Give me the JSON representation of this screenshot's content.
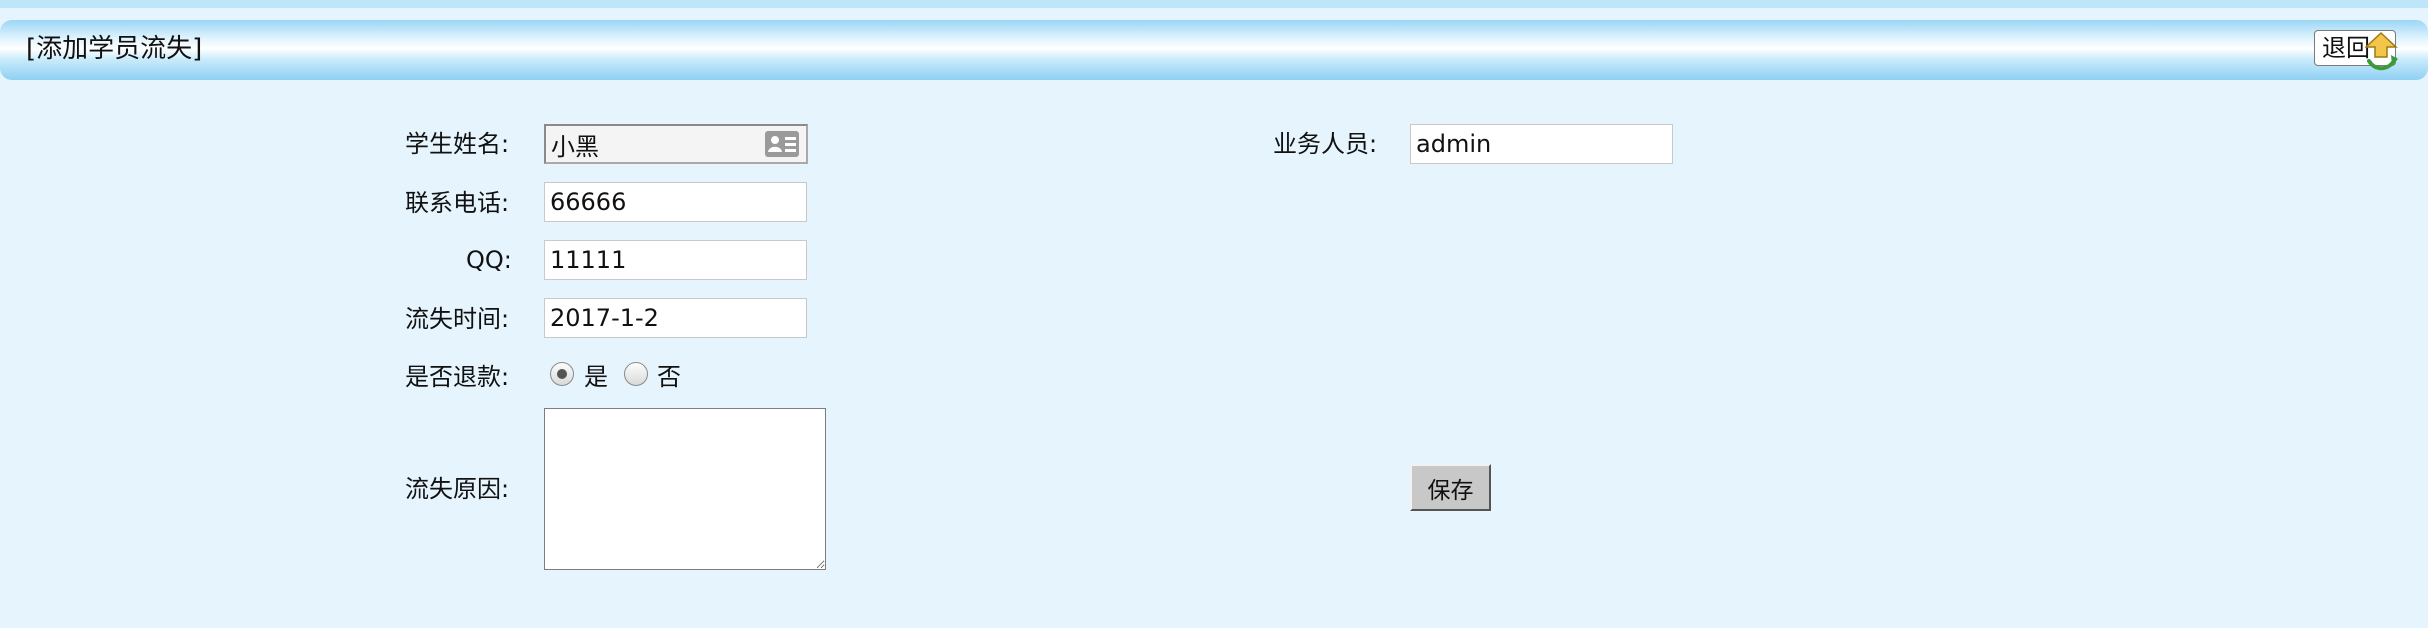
{
  "page": {
    "title": "[添加学员流失]",
    "back_label": "退回"
  },
  "form": {
    "student_name": {
      "label": "学生姓名:",
      "value": "小黑"
    },
    "phone": {
      "label": "联系电话:",
      "value": "66666"
    },
    "qq": {
      "label": "QQ:",
      "value": "11111"
    },
    "churn_date": {
      "label": "流失时间:",
      "value": "2017-1-2"
    },
    "refund": {
      "label": "是否退款:",
      "options": [
        {
          "label": "是",
          "checked": true
        },
        {
          "label": "否",
          "checked": false
        }
      ]
    },
    "reason": {
      "label": "流失原因:",
      "value": ""
    },
    "salesperson": {
      "label": "业务人员:",
      "value": "admin"
    },
    "save_label": "保存"
  },
  "icons": {
    "back": "return-arrow-icon",
    "student_picker": "id-card-icon"
  },
  "colors": {
    "page_background": "#e6f5fd",
    "title_bar": "#8fd0f3",
    "button_face": "#c8c8c8"
  }
}
